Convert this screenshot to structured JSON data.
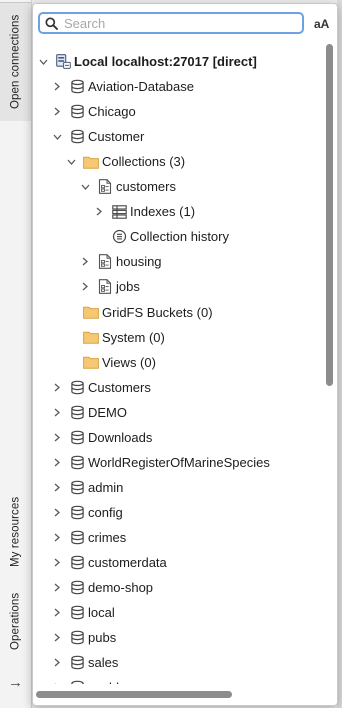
{
  "sidebar": {
    "tab_open_connections": "Open connections",
    "tab_my_resources": "My resources",
    "tab_operations": "Operations",
    "arrow": "→"
  },
  "search": {
    "placeholder": "Search",
    "value": "",
    "match_case_label": "aA"
  },
  "tree": {
    "root": {
      "label": "Local localhost:27017 [direct]",
      "expanded": true
    },
    "rows": [
      {
        "label": "Aviation-Database",
        "type": "db",
        "level": 1,
        "chevron": "right"
      },
      {
        "label": "Chicago",
        "type": "db",
        "level": 1,
        "chevron": "right"
      },
      {
        "label": "Customer",
        "type": "db",
        "level": 1,
        "chevron": "down"
      },
      {
        "label": "Collections (3)",
        "type": "folder",
        "level": 2,
        "chevron": "down"
      },
      {
        "label": "customers",
        "type": "collection",
        "level": 3,
        "chevron": "down"
      },
      {
        "label": "Indexes (1)",
        "type": "indexes",
        "level": 4,
        "chevron": "right"
      },
      {
        "label": "Collection history",
        "type": "history",
        "level": 4,
        "chevron": "none"
      },
      {
        "label": "housing",
        "type": "collection",
        "level": 3,
        "chevron": "right"
      },
      {
        "label": "jobs",
        "type": "collection",
        "level": 3,
        "chevron": "right"
      },
      {
        "label": "GridFS Buckets (0)",
        "type": "folder",
        "level": 2,
        "chevron": "none"
      },
      {
        "label": "System (0)",
        "type": "folder",
        "level": 2,
        "chevron": "none"
      },
      {
        "label": "Views (0)",
        "type": "folder",
        "level": 2,
        "chevron": "none"
      },
      {
        "label": "Customers",
        "type": "db",
        "level": 1,
        "chevron": "right"
      },
      {
        "label": "DEMO",
        "type": "db",
        "level": 1,
        "chevron": "right"
      },
      {
        "label": "Downloads",
        "type": "db",
        "level": 1,
        "chevron": "right"
      },
      {
        "label": "WorldRegisterOfMarineSpecies",
        "type": "db",
        "level": 1,
        "chevron": "right"
      },
      {
        "label": "admin",
        "type": "db",
        "level": 1,
        "chevron": "right"
      },
      {
        "label": "config",
        "type": "db",
        "level": 1,
        "chevron": "right"
      },
      {
        "label": "crimes",
        "type": "db",
        "level": 1,
        "chevron": "right"
      },
      {
        "label": "customerdata",
        "type": "db",
        "level": 1,
        "chevron": "right"
      },
      {
        "label": "demo-shop",
        "type": "db",
        "level": 1,
        "chevron": "right"
      },
      {
        "label": "local",
        "type": "db",
        "level": 1,
        "chevron": "right"
      },
      {
        "label": "pubs",
        "type": "db",
        "level": 1,
        "chevron": "right"
      },
      {
        "label": "sales",
        "type": "db",
        "level": 1,
        "chevron": "right"
      },
      {
        "label": "world",
        "type": "db",
        "level": 1,
        "chevron": "right"
      }
    ]
  },
  "colors": {
    "search_border": "#6fa0e4",
    "folder": "#f7c873",
    "folder_stroke": "#d9a443"
  }
}
